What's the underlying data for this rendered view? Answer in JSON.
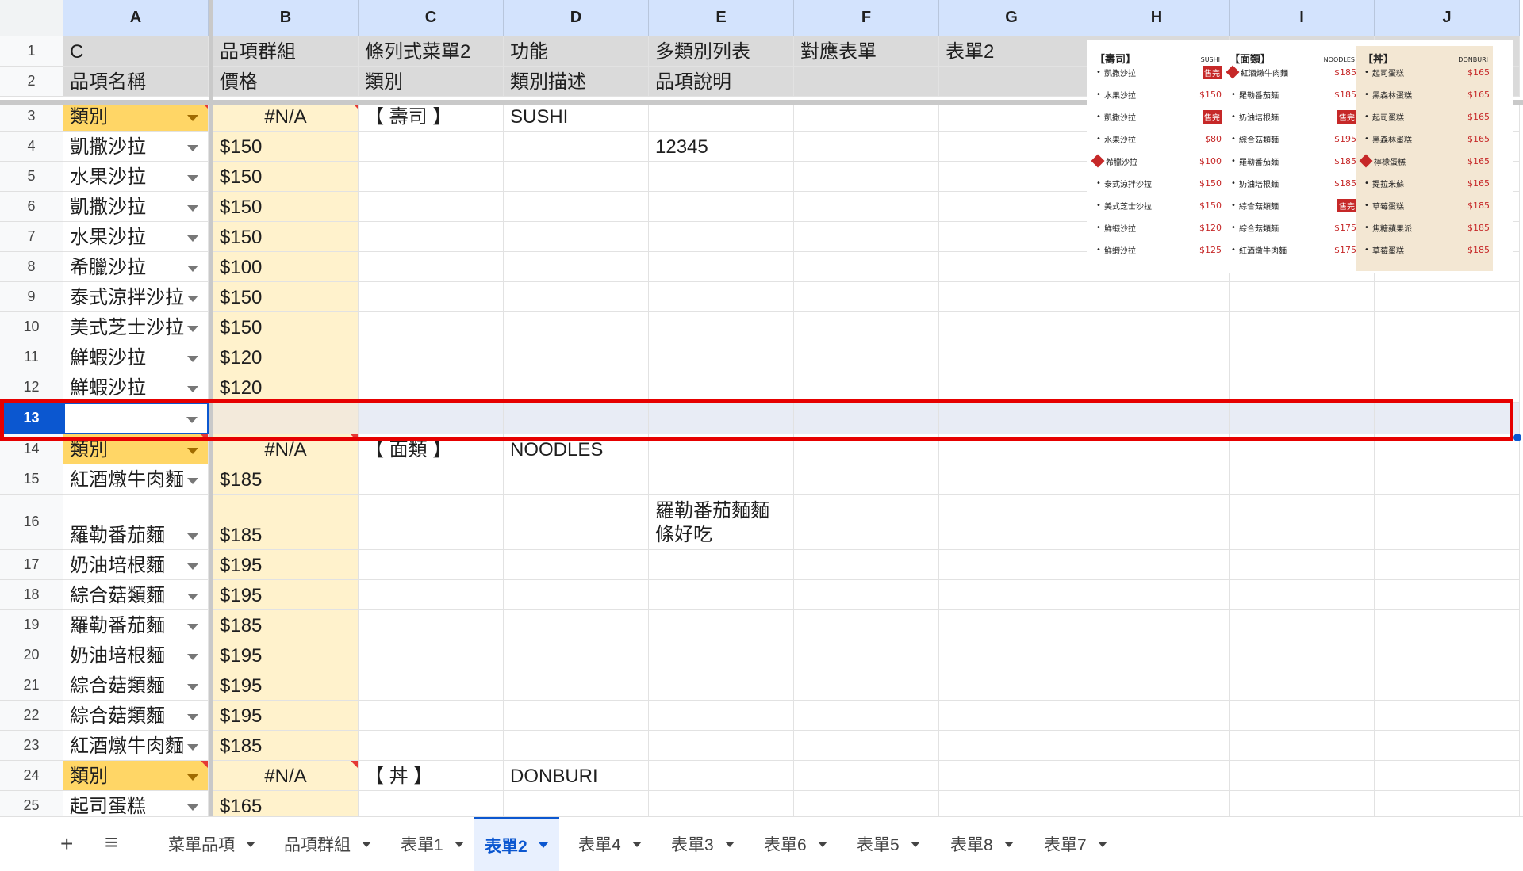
{
  "columns": [
    "A",
    "B",
    "C",
    "D",
    "E",
    "F",
    "G",
    "H",
    "I",
    "J"
  ],
  "rows": [
    {
      "num": "1",
      "h": 38,
      "cells": [
        "C",
        "品項群組",
        "條列式菜單2",
        "功能",
        "多類別列表",
        "對應表單",
        "表單2",
        "",
        "",
        ""
      ],
      "type": "hdr"
    },
    {
      "num": "2",
      "h": 38,
      "cells": [
        "品項名稱",
        "價格",
        "類別",
        "類別描述",
        "品項說明",
        "",
        "",
        "",
        "",
        ""
      ],
      "type": "hdr"
    },
    {
      "num": "3",
      "h": 38,
      "cells": [
        "類別",
        "#N/A",
        "【 壽司 】",
        "SUSHI",
        "",
        "",
        "",
        "",
        "",
        ""
      ],
      "type": "cat"
    },
    {
      "num": "4",
      "h": 38,
      "cells": [
        "凱撒沙拉",
        "$150",
        "",
        "",
        "12345",
        "",
        "",
        "",
        "",
        ""
      ]
    },
    {
      "num": "5",
      "h": 38,
      "cells": [
        "水果沙拉",
        "$150",
        "",
        "",
        "",
        "",
        "",
        "",
        "",
        ""
      ]
    },
    {
      "num": "6",
      "h": 38,
      "cells": [
        "凱撒沙拉",
        "$150",
        "",
        "",
        "",
        "",
        "",
        "",
        "",
        ""
      ]
    },
    {
      "num": "7",
      "h": 38,
      "cells": [
        "水果沙拉",
        "$150",
        "",
        "",
        "",
        "",
        "",
        "",
        "",
        ""
      ]
    },
    {
      "num": "8",
      "h": 38,
      "cells": [
        "希臘沙拉",
        "$100",
        "",
        "",
        "",
        "",
        "",
        "",
        "",
        ""
      ]
    },
    {
      "num": "9",
      "h": 38,
      "cells": [
        "泰式涼拌沙拉",
        "$150",
        "",
        "",
        "",
        "",
        "",
        "",
        "",
        ""
      ]
    },
    {
      "num": "10",
      "h": 38,
      "cells": [
        "美式芝士沙拉",
        "$150",
        "",
        "",
        "",
        "",
        "",
        "",
        "",
        ""
      ]
    },
    {
      "num": "11",
      "h": 38,
      "cells": [
        "鮮蝦沙拉",
        "$120",
        "",
        "",
        "",
        "",
        "",
        "",
        "",
        ""
      ]
    },
    {
      "num": "12",
      "h": 38,
      "cells": [
        "鮮蝦沙拉",
        "$120",
        "",
        "",
        "",
        "",
        "",
        "",
        "",
        ""
      ]
    },
    {
      "num": "13",
      "h": 40,
      "cells": [
        "",
        "",
        "",
        "",
        "",
        "",
        "",
        "",
        "",
        ""
      ],
      "type": "sel"
    },
    {
      "num": "14",
      "h": 38,
      "cells": [
        "類別",
        "#N/A",
        "【 面類 】",
        "NOODLES",
        "",
        "",
        "",
        "",
        "",
        ""
      ],
      "type": "cat"
    },
    {
      "num": "15",
      "h": 38,
      "cells": [
        "紅酒燉牛肉麵",
        "$185",
        "",
        "",
        "",
        "",
        "",
        "",
        "",
        ""
      ]
    },
    {
      "num": "16",
      "h": 70,
      "cells": [
        "羅勒番茄麵",
        "$185",
        "",
        "",
        "羅勒番茄麵麵條好吃",
        "",
        "",
        "",
        "",
        ""
      ]
    },
    {
      "num": "17",
      "h": 38,
      "cells": [
        "奶油培根麵",
        "$195",
        "",
        "",
        "",
        "",
        "",
        "",
        "",
        ""
      ]
    },
    {
      "num": "18",
      "h": 38,
      "cells": [
        "綜合菇類麵",
        "$195",
        "",
        "",
        "",
        "",
        "",
        "",
        "",
        ""
      ]
    },
    {
      "num": "19",
      "h": 38,
      "cells": [
        "羅勒番茄麵",
        "$185",
        "",
        "",
        "",
        "",
        "",
        "",
        "",
        ""
      ]
    },
    {
      "num": "20",
      "h": 38,
      "cells": [
        "奶油培根麵",
        "$195",
        "",
        "",
        "",
        "",
        "",
        "",
        "",
        ""
      ]
    },
    {
      "num": "21",
      "h": 38,
      "cells": [
        "綜合菇類麵",
        "$195",
        "",
        "",
        "",
        "",
        "",
        "",
        "",
        ""
      ]
    },
    {
      "num": "22",
      "h": 38,
      "cells": [
        "綜合菇類麵",
        "$195",
        "",
        "",
        "",
        "",
        "",
        "",
        "",
        ""
      ]
    },
    {
      "num": "23",
      "h": 38,
      "cells": [
        "紅酒燉牛肉麵",
        "$185",
        "",
        "",
        "",
        "",
        "",
        "",
        "",
        ""
      ]
    },
    {
      "num": "24",
      "h": 38,
      "cells": [
        "類別",
        "#N/A",
        "【 丼 】",
        "DONBURI",
        "",
        "",
        "",
        "",
        "",
        ""
      ],
      "type": "cat"
    },
    {
      "num": "25",
      "h": 38,
      "cells": [
        "起司蛋糕",
        "$165",
        "",
        "",
        "",
        "",
        "",
        "",
        "",
        ""
      ]
    }
  ],
  "menu_image": {
    "columns": [
      {
        "title": "【壽司】",
        "sub": "SUSHI",
        "items": [
          {
            "name": "凱撒沙拉",
            "price": "售完",
            "sold": true
          },
          {
            "name": "水果沙拉",
            "price": "$150"
          },
          {
            "name": "凱撒沙拉",
            "price": "售完",
            "sold": true
          },
          {
            "name": "水果沙拉",
            "price": "$80"
          },
          {
            "name": "希臘沙拉",
            "price": "$100",
            "icon": true
          },
          {
            "name": "泰式涼拌沙拉",
            "price": "$150"
          },
          {
            "name": "美式芝士沙拉",
            "price": "$150"
          },
          {
            "name": "鮮蝦沙拉",
            "price": "$120"
          },
          {
            "name": "鮮蝦沙拉",
            "price": "$125"
          }
        ]
      },
      {
        "title": "【面類】",
        "sub": "NOODLES",
        "items": [
          {
            "name": "紅酒燉牛肉麵",
            "price": "$185",
            "icon": true
          },
          {
            "name": "羅勒番茄麵",
            "price": "$185"
          },
          {
            "name": "奶油培根麵",
            "price": "售完",
            "sold": true
          },
          {
            "name": "綜合菇類麵",
            "price": "$195"
          },
          {
            "name": "羅勒番茄麵",
            "price": "$185"
          },
          {
            "name": "奶油培根麵",
            "price": "$185"
          },
          {
            "name": "綜合菇類麵",
            "price": "售完",
            "sold": true
          },
          {
            "name": "綜合菇類麵",
            "price": "$175"
          },
          {
            "name": "紅酒燉牛肉麵",
            "price": "$175"
          }
        ]
      },
      {
        "title": "【丼】",
        "sub": "DONBURI",
        "items": [
          {
            "name": "起司蛋糕",
            "price": "$165"
          },
          {
            "name": "黑森林蛋糕",
            "price": "$165"
          },
          {
            "name": "起司蛋糕",
            "price": "$165"
          },
          {
            "name": "黑森林蛋糕",
            "price": "$165"
          },
          {
            "name": "檸檬蛋糕",
            "price": "$165",
            "icon": true
          },
          {
            "name": "提拉米蘇",
            "price": "$165"
          },
          {
            "name": "草莓蛋糕",
            "price": "$185"
          },
          {
            "name": "焦糖蘋果派",
            "price": "$185"
          },
          {
            "name": "草莓蛋糕",
            "price": "$185"
          }
        ]
      }
    ]
  },
  "tabbar": {
    "add_icon": "plus-icon",
    "list_icon": "menu-list-icon",
    "tabs": [
      "菜單品項",
      "品項群組",
      "表單1",
      "表單2",
      "表單4",
      "表單3",
      "表單6",
      "表單5",
      "表單8",
      "表單7"
    ],
    "active_index": 3
  },
  "colors": {
    "selection": "#0b57d0",
    "highlight_box": "#e60000",
    "category_fill": "#ffd666",
    "price_fill": "#fff2cc"
  }
}
